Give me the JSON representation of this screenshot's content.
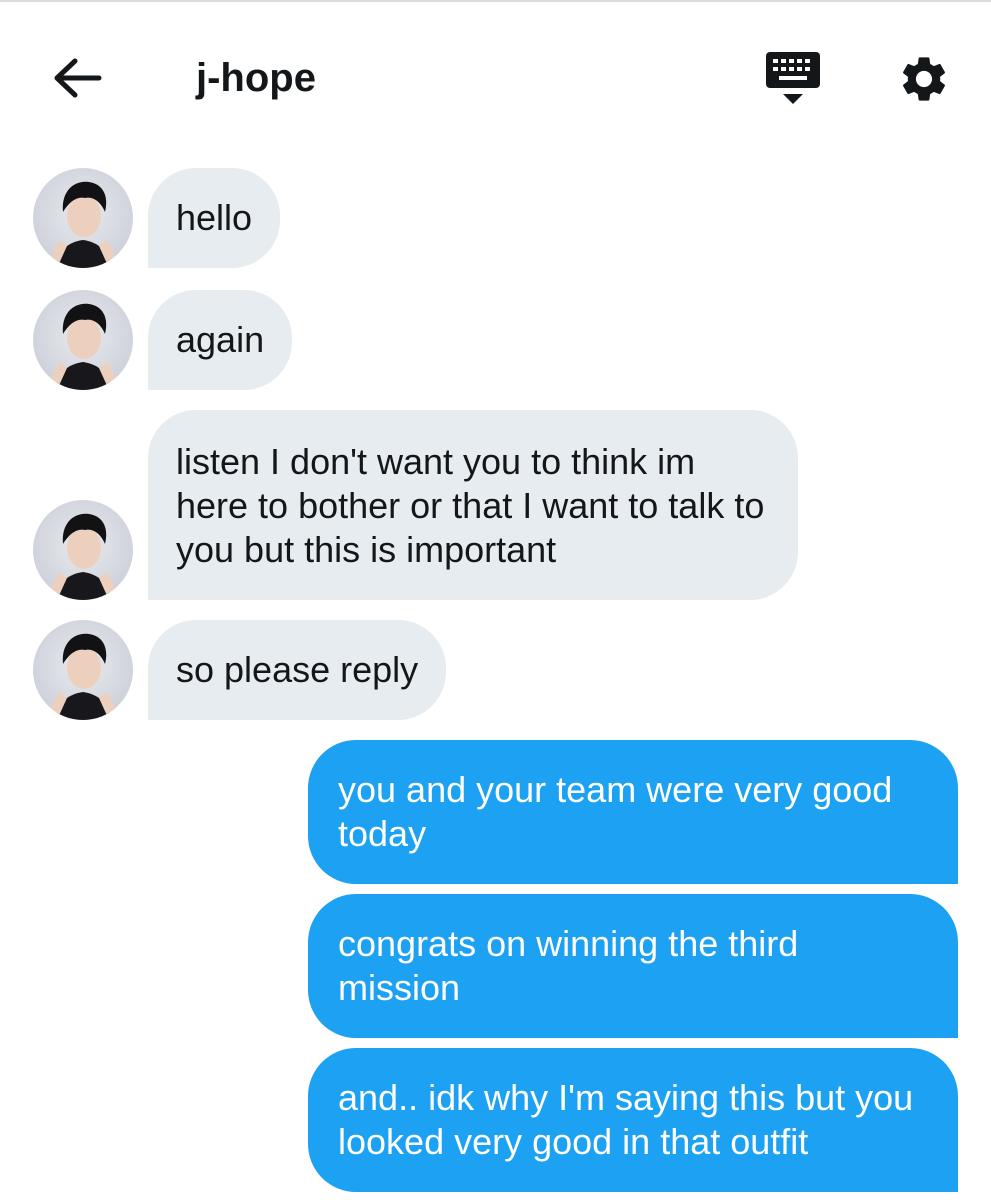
{
  "header": {
    "title": "j-hope",
    "icons": {
      "back": "arrow-left-icon",
      "keyboard": "keyboard-icon",
      "settings": "gear-icon"
    }
  },
  "colors": {
    "incoming_bubble": "#e6ecf0",
    "outgoing_bubble": "#1da1f2",
    "outgoing_text": "#ffffff",
    "text": "#14171a"
  },
  "messages": [
    {
      "direction": "incoming",
      "text": "hello"
    },
    {
      "direction": "incoming",
      "text": "again"
    },
    {
      "direction": "incoming",
      "text": "listen I don't want you to think im here to bother or that I want to talk to you but this is important"
    },
    {
      "direction": "incoming",
      "text": "so please reply"
    },
    {
      "direction": "outgoing",
      "text": "you and your team were very good today"
    },
    {
      "direction": "outgoing",
      "text": "congrats on winning the third mission"
    },
    {
      "direction": "outgoing",
      "text": "and.. idk why I'm saying this but you looked very good in that outfit"
    }
  ]
}
